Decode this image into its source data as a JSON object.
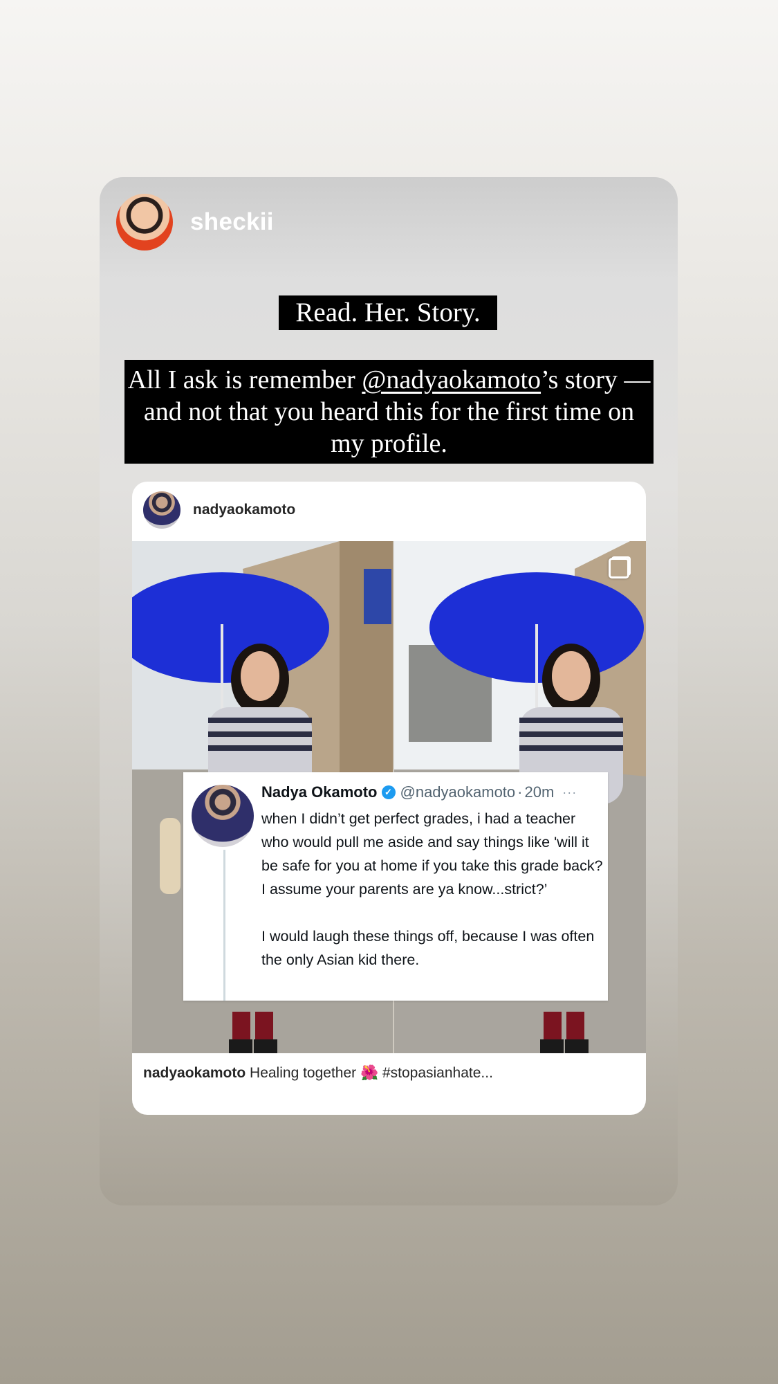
{
  "author": {
    "username": "sheckii"
  },
  "headline": "Read. Her. Story.",
  "quote": {
    "before": "All I ask is remember ",
    "mention": "@nadyaokamoto",
    "after": "’s story — and not that you heard this for the first time on my profile."
  },
  "shared_post": {
    "username": "nadyaokamoto",
    "caption_user": "nadyaokamoto",
    "caption_text": " Healing together 🌺 #stopasianhate...",
    "tweet": {
      "name": "Nadya Okamoto",
      "handle": "@nadyaokamoto",
      "separator": "·",
      "time": "20m",
      "more": "···",
      "verified_mark": "✓",
      "body": "when I didn’t get perfect grades, i had a teacher who would pull me aside and say things like 'will it be safe for you at home if you take this grade back? I assume your parents are ya know...strict?’\n\nI would laugh these things off, because I was often the only Asian kid there."
    }
  },
  "icons": {
    "verified": "verified-badge-icon",
    "multi_photo": "multiple-photos-icon",
    "more": "more-options-icon"
  },
  "colors": {
    "verified_blue": "#1d9bf0",
    "umbrella_blue": "#1d2fd6",
    "label_bg": "#000000"
  }
}
